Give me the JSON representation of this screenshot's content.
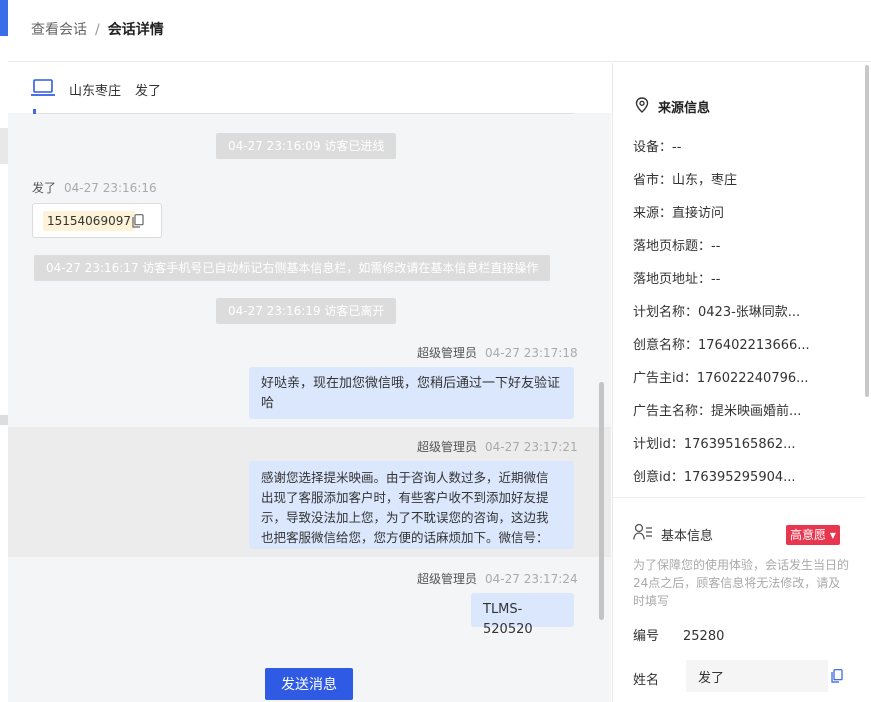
{
  "breadcrumb": {
    "parent": "查看会话",
    "separator": "/",
    "current": "会话详情"
  },
  "chat_header": {
    "location": "山东枣庄",
    "visitor_name": "发了"
  },
  "messages": {
    "sys1": "04-27 23:16:09 访客已进线",
    "visitor_msg": {
      "sender": "发了",
      "time": "04-27 23:16:16",
      "phone": "15154069097"
    },
    "sys2": "04-27 23:16:17 访客手机号已自动标记右侧基本信息栏，如需修改请在基本信息栏直接操作",
    "sys3": "04-27 23:16:19 访客已离开",
    "agent1": {
      "sender": "超级管理员",
      "time": "04-27 23:17:18",
      "line1": "好哒亲，现在加您微信哦，您稍后通过一下好友验证",
      "line2": "哈"
    },
    "agent2": {
      "sender": "超级管理员",
      "time": "04-27 23:17:21",
      "lines": [
        "感谢您选择提米映画。由于咨询人数过多，近期微信",
        "出现了客服添加客户时，有些客户收不到添加好友提",
        "示，导致没法加上您，为了不耽误您的咨询，这边我",
        "也把客服微信给您，您方便的话麻烦加下。微信号："
      ]
    },
    "agent3": {
      "sender": "超级管理员",
      "time": "04-27 23:17:24",
      "text": "TLMS-520520"
    }
  },
  "send_button": "发送消息",
  "source_info": {
    "title": "来源信息",
    "fields": [
      {
        "key": "设备：",
        "value": "--"
      },
      {
        "key": "省市：",
        "value": "山东，枣庄"
      },
      {
        "key": "来源：",
        "value": "直接访问"
      },
      {
        "key": "落地页标题：",
        "value": "--"
      },
      {
        "key": "落地页地址：",
        "value": "--"
      },
      {
        "key": "计划名称：",
        "value": "0423-张琳同款..."
      },
      {
        "key": "创意名称：",
        "value": "17640221366​6..."
      },
      {
        "key": "广告主id：",
        "value": "176022240796..."
      },
      {
        "key": "广告主名称：",
        "value": "提米映画婚前..."
      },
      {
        "key": "计划id：",
        "value": "176395165862..."
      },
      {
        "key": "创意id：",
        "value": "176395295904..."
      }
    ]
  },
  "basic_info": {
    "title": "基本信息",
    "intent_badge": "高意愿 ▾",
    "note": "为了保障您的使用体验，会话发生当日的24点之后，顾客信息将无法修改，请及时填写",
    "number_label": "编号",
    "number_value": "25280",
    "name_label": "姓名",
    "name_value": "发了"
  },
  "colors": {
    "primary": "#2f5be4",
    "intent": "#e8364f",
    "agent_bubble": "#dbe7fd"
  }
}
